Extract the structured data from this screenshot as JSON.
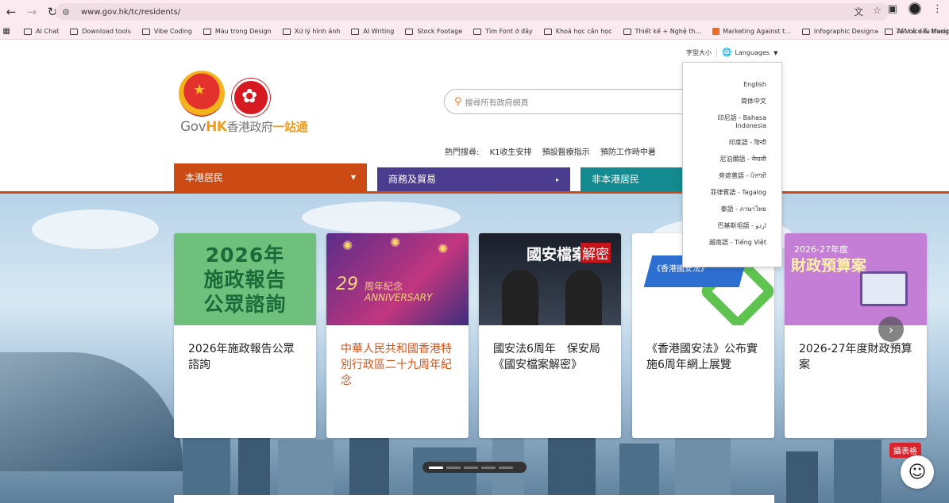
{
  "browser": {
    "url": "www.gov.hk/tc/residents/",
    "bookmarks": [
      {
        "label": "AI Chat",
        "type": "folder"
      },
      {
        "label": "Download tools",
        "type": "folder"
      },
      {
        "label": "Vibe Coding",
        "type": "folder"
      },
      {
        "label": "Màu trong Design",
        "type": "folder"
      },
      {
        "label": "Xử lý hình ảnh",
        "type": "folder"
      },
      {
        "label": "AI Writing",
        "type": "folder"
      },
      {
        "label": "Stock Footage",
        "type": "folder"
      },
      {
        "label": "Tìm Font ở đây",
        "type": "folder"
      },
      {
        "label": "Khoá học cần học",
        "type": "folder"
      },
      {
        "label": "Thiết kế + Nghệ th...",
        "type": "folder"
      },
      {
        "label": "Marketing Against t...",
        "type": "site"
      },
      {
        "label": "Infographic Design",
        "type": "folder"
      },
      {
        "label": "AI Voice & Music",
        "type": "folder"
      }
    ],
    "more_bookmarks": "»",
    "all_bookmarks": "Tất cả dấu trang"
  },
  "header": {
    "font_size_label": "字型大小",
    "languages_label": "Languages",
    "brand_gov": "Gov",
    "brand_hk": "HK",
    "brand_zh": "香港政府",
    "brand_one": "一站通",
    "search_placeholder": "搜尋所有政府網頁",
    "hot_label": "熱門搜尋:",
    "hot_items": [
      "K1收生安排",
      "預設醫療指示",
      "預防工作時中暑"
    ]
  },
  "tabs": {
    "residents": "本港居民",
    "business": "商務及貿易",
    "nonresidents": "非本港居民"
  },
  "cards": [
    {
      "image_lines": [
        "2026年",
        "施政報告",
        "公眾諮詢"
      ],
      "title": "2026年施政報告公眾諮詢"
    },
    {
      "image_big": "29",
      "image_sub": "周年紀念",
      "image_sub2": "ANNIVERSARY",
      "title": "中華人民共和國香港特別行政區二十九周年紀念"
    },
    {
      "image_title": "國安檔案",
      "image_tag": "解密",
      "title": "國安法6周年　保安局《國安檔案解密》"
    },
    {
      "image_ribbon": "《香港國安法》",
      "title": "《香港國安法》公布實施6周年網上展覽"
    },
    {
      "image_small": "2026-27年度",
      "image_title": "財政預算案",
      "title": "2026-27年度財政預算案"
    }
  ],
  "mascot_label": "攝表格",
  "languages": [
    "English",
    "简体中文",
    "印尼語 - Bahasa",
    "Indonesia",
    "印度語 - हिन्दी",
    "尼泊爾語 - नेपाली",
    "旁遮普語 - ਪੰਜਾਬੀ",
    "菲律賓語 - Tagalog",
    "泰語 - ภาษาไทย",
    "巴基斯坦語 - اردو",
    "越南語 - Tiếng Việt"
  ],
  "colors": {
    "residents_tab": "#cc4a14",
    "business_tab": "#4b3c8f",
    "nonresidents_tab": "#138a8f",
    "brand_orange": "#f29a19"
  }
}
